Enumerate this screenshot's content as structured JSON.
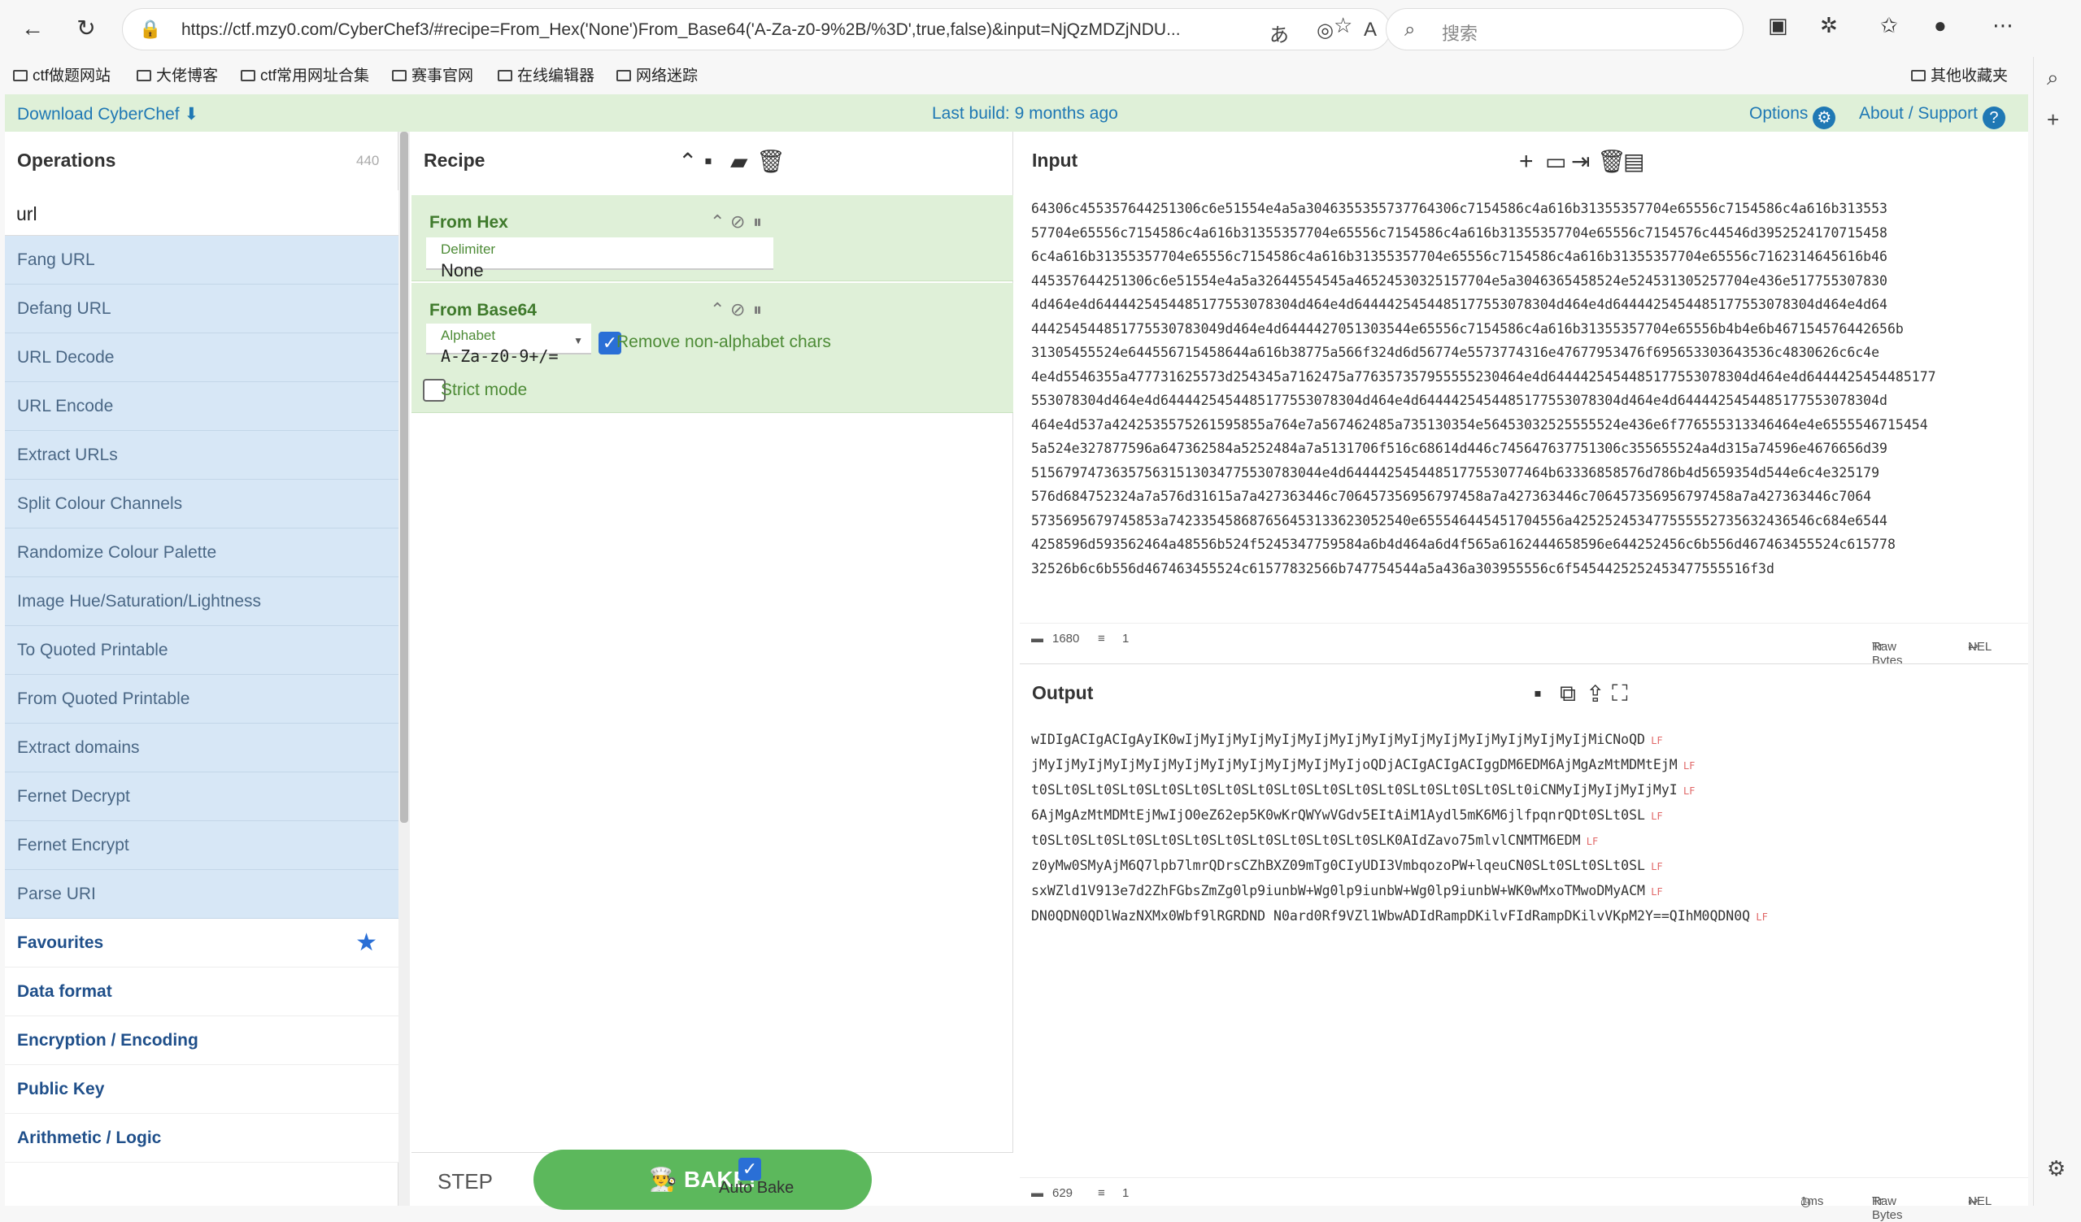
{
  "browser": {
    "url": "https://ctf.mzy0.com/CyberChef3/#recipe=From_Hex('None')From_Base64('A-Za-z0-9%2B/%3D',true,false)&input=NjQzMDZjNDU...",
    "search_placeholder": "搜索",
    "bookmarks": [
      "ctf做题网站",
      "大佬博客",
      "ctf常用网址合集",
      "赛事官网",
      "在线编辑器",
      "网络迷踪"
    ],
    "other_bookmarks": "其他收藏夹"
  },
  "banner": {
    "download": "Download CyberChef",
    "last_build": "Last build: 9 months ago",
    "options": "Options",
    "about": "About / Support"
  },
  "operations": {
    "title": "Operations",
    "count": "440",
    "search_value": "url",
    "items": [
      "Fang URL",
      "Defang URL",
      "URL Decode",
      "URL Encode",
      "Extract URLs",
      "Split Colour Channels",
      "Randomize Colour Palette",
      "Image Hue/Saturation/Lightness",
      "To Quoted Printable",
      "From Quoted Printable",
      "Extract domains",
      "Fernet Decrypt",
      "Fernet Encrypt",
      "Parse URI"
    ],
    "categories": [
      "Favourites",
      "Data format",
      "Encryption / Encoding",
      "Public Key",
      "Arithmetic / Logic"
    ]
  },
  "recipe": {
    "title": "Recipe",
    "op1": {
      "name": "From Hex",
      "delimiter_label": "Delimiter",
      "delimiter_value": "None"
    },
    "op2": {
      "name": "From Base64",
      "alphabet_label": "Alphabet",
      "alphabet_value": "A-Za-z0-9+/=",
      "remove_label": "Remove non-alphabet chars",
      "strict_label": "Strict mode"
    },
    "step": "STEP",
    "bake": "BAKE!",
    "auto_bake": "Auto Bake"
  },
  "input": {
    "title": "Input",
    "lines": [
      "64306c455357644251306c6e51554e4a5a3046355355737764306c7154586c4a616b31355357704e65556c7154586c4a616b313553",
      "57704e65556c7154586c4a616b31355357704e65556c7154586c4a616b31355357704e65556c7154576c44546d3952524170715458",
      "6c4a616b31355357704e65556c7154586c4a616b31355357704e65556c7154586c4a616b31355357704e65556c7162314645616b46",
      "445357644251306c6e51554e4a5a32644554545a46524530325157704e5a3046365458524e524531305257704e436e517755307830",
      "4d464e4d6444425454485177553078304d464e4d6444425454485177553078304d464e4d6444425454485177553078304d464e4d64",
      "444254544851775530783049d464e4d6444427051303544e65556c7154586c4a616b31355357704e65556b4b4e6b467154576442656b",
      "31305455524e644556715458644a616b38775a566f324d6d56774e5573774316e47677953476f695653303643536c4830626c6c4e",
      "4e4d5546355a477731625573d254345a7162475a776357357955555230464e4d6444425454485177553078304d464e4d6444425454485177",
      "553078304d464e4d6444425454485177553078304d464e4d6444425454485177553078304d464e4d6444425454485177553078304d",
      "464e4d537a4242535575261595855a764e7a567462485a735130354e56453032525555524e436e6f776555313346464e4e6555546715454",
      "5a524e327877596a647362584a5252484a7a5131706f516c68614d446c745647637751306c355655524a4d315a74596e4676656d39",
      "515679747363575631513034775530783044e4d6444425454485177553077464b63336858576d786b4d5659354d544e6c4e325179",
      "576d684752324a7a576d31615a7a427363446c706457356956797458a7a427363446c706457356956797458a7a427363446c7064",
      "5735695679745853a742335458687656453133623052540e655546445451704556a425252453477555552735632436546c684e6544",
      "4258596d593562464a48556b524f5245347759584a6b4d464a6d4f565a6162444658596e644252456c6b556d467463455524c615778",
      "32526b6c6b556d467463455524c61577832566b747754544a5a436a303955556c6f5454425252453477555516f3d"
    ],
    "chars": "1680",
    "line_count": "1",
    "encoding": "Raw Bytes",
    "eol": "NEL"
  },
  "output": {
    "title": "Output",
    "lines": [
      "wIDIgACIgACIgAyIK0wIjMyIjMyIjMyIjMyIjMyIjMyIjMyIjMyIjMyIjMyIjMyIjMyIjMiCNoQD",
      "jMyIjMyIjMyIjMyIjMyIjMyIjMyIjMyIjMyIjMyIjoQDjACIgACIgACIggDM6EDM6AjMgAzMtMDMtEjM",
      "t0SLt0SLt0SLt0SLt0SLt0SLt0SLt0SLt0SLt0SLt0SLt0SLt0SLt0SLt0SLt0iCNMyIjMyIjMyIjMyI",
      "6AjMgAzMtMDMtEjMwIjO0eZ62ep5K0wKrQWYwVGdv5EItAiM1Aydl5mK6M6jlfpqnrQDt0SLt0SL",
      "t0SLt0SLt0SLt0SLt0SLt0SLt0SLt0SLt0SLt0SLt0SLK0AIdZavo75mlvlCNMTM6EDM",
      "z0yMw0SMyAjM6Q7lpb7lmrQDrsCZhBXZ09mTg0CIyUDI3VmbqozoPW+lqeuCN0SLt0SLt0SLt0SL",
      "sxWZld1V913e7d2ZhFGbsZmZg0lp9iunbW+Wg0lp9iunbW+Wg0lp9iunbW+WK0wMxoTMwoDMyACM",
      "DN0QDN0QDlWazNXMx0Wbf9lRGRDND N0ard0Rf9VZl1WbwADIdRampDKilvFIdRampDKilvVKpM2Y==QIhM0QDN0Q"
    ],
    "chars": "629",
    "line_count": "1",
    "time": "1ms",
    "encoding": "Raw Bytes",
    "eol": "NEL"
  }
}
